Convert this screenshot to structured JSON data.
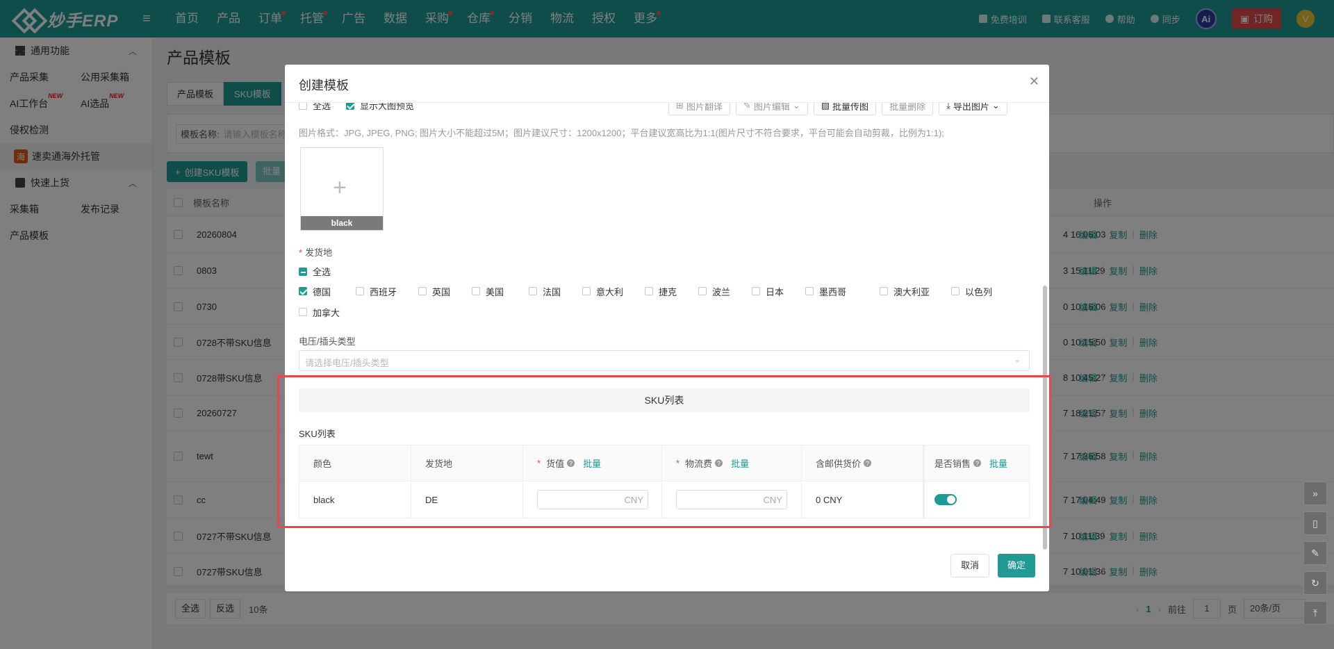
{
  "topbar": {
    "brand": "妙手ERP",
    "nav": [
      {
        "label": "首页",
        "dot": false
      },
      {
        "label": "产品",
        "dot": false
      },
      {
        "label": "订单",
        "dot": true
      },
      {
        "label": "托管",
        "dot": true
      },
      {
        "label": "广告",
        "dot": false
      },
      {
        "label": "数据",
        "dot": false
      },
      {
        "label": "采购",
        "dot": true
      },
      {
        "label": "仓库",
        "dot": true
      },
      {
        "label": "分销",
        "dot": false
      },
      {
        "label": "物流",
        "dot": false
      },
      {
        "label": "授权",
        "dot": false
      },
      {
        "label": "更多",
        "dot": true
      }
    ],
    "right": {
      "training": "免费培训",
      "contact": "联系客服",
      "help": "帮助",
      "sync": "同步",
      "ai": "Ai",
      "order": "订购"
    }
  },
  "sidebar": {
    "group1": "通用功能",
    "row1": [
      "产品采集",
      "公用采集箱"
    ],
    "row2": [
      "AI工作台",
      "AI选品"
    ],
    "new_badge": "NEW",
    "infringe": "侵权检测",
    "smt_icon": "海",
    "smt": "速卖通海外托管",
    "group2": "快速上货",
    "row3": [
      "采集箱",
      "发布记录"
    ],
    "template": "产品模板"
  },
  "main": {
    "title": "产品模板",
    "tabs": [
      "产品模板",
      "SKU模板"
    ],
    "filter_label": "模板名称:",
    "filter_placeholder": "请输入模板名称",
    "create_btn": "创建SKU模板",
    "batch_btn": "批量",
    "table_header": {
      "name": "模板名称",
      "ops": "操作"
    },
    "rows": [
      {
        "name": "20260804",
        "time": "4 16:06:03",
        "h": 52
      },
      {
        "name": "0803",
        "time": "3 15:11:29",
        "h": 52
      },
      {
        "name": "0730",
        "time": "0 10:16:06",
        "h": 51
      },
      {
        "name": "0728不带SKU信息",
        "time": "0 10:15:50",
        "h": 51
      },
      {
        "name": "0728带SKU信息",
        "time": "8 10:45:27",
        "h": 51
      },
      {
        "name": "20260727",
        "time": "7 18:21:57",
        "h": 51
      },
      {
        "name": "tewt",
        "time": "7 17:36:58",
        "h": 74
      },
      {
        "name": "cc",
        "time": "7 17:04:49",
        "h": 52
      },
      {
        "name": "0727不带SKU信息",
        "time": "7 10:11:39",
        "h": 51
      },
      {
        "name": "0727带SKU信息",
        "time": "7 10:01:36",
        "h": 51
      }
    ],
    "ops": [
      "编辑",
      "复制",
      "删除"
    ],
    "footer": {
      "select_all": "全选",
      "invert": "反选",
      "count": "10条",
      "page": "1",
      "goto": "前往",
      "page_input": "1",
      "page_unit": "页",
      "page_size": "20条/页"
    }
  },
  "modal": {
    "title": "创建模板",
    "select_all_img": "全选",
    "show_preview": "显示大图预览",
    "tools": [
      "图片翻译",
      "图片编辑",
      "批量传图",
      "批量删除",
      "导出图片"
    ],
    "img_hint": "图片格式：JPG, JPEG, PNG; 图片大小不能超过5M；图片建议尺寸：1200x1200；平台建议宽高比为1:1(图片尺寸不符合要求，平台可能会自动剪裁，比例为1:1);",
    "img_caption": "black",
    "ship_label": "发货地",
    "ship_select_all": "全选",
    "countries": [
      {
        "label": "德国",
        "checked": true
      },
      {
        "label": "西班牙",
        "checked": false
      },
      {
        "label": "英国",
        "checked": false
      },
      {
        "label": "美国",
        "checked": false
      },
      {
        "label": "法国",
        "checked": false
      },
      {
        "label": "意大利",
        "checked": false
      },
      {
        "label": "捷克",
        "checked": false
      },
      {
        "label": "波兰",
        "checked": false
      },
      {
        "label": "日本",
        "checked": false
      },
      {
        "label": "墨西哥",
        "checked": false
      },
      {
        "label": "澳大利亚",
        "checked": false
      },
      {
        "label": "以色列",
        "checked": false
      },
      {
        "label": "加拿大",
        "checked": false
      }
    ],
    "voltage_label": "电压/插头类型",
    "voltage_placeholder": "请选择电压/插头类型",
    "sku_section": "SKU列表",
    "sku_sub": "SKU列表",
    "sku_headers": {
      "color": "颜色",
      "origin": "发货地",
      "value": "货值",
      "shipping": "物流费",
      "price": "含邮供货价",
      "on_sale": "是否销售",
      "batch": "批量"
    },
    "sku_row": {
      "color": "black",
      "origin": "DE",
      "currency": "CNY",
      "price": "0 CNY",
      "on_sale": true
    },
    "cancel": "取消",
    "confirm": "确定"
  },
  "colors": {
    "brand": "#1f9a95",
    "highlight": "#e8474a"
  }
}
